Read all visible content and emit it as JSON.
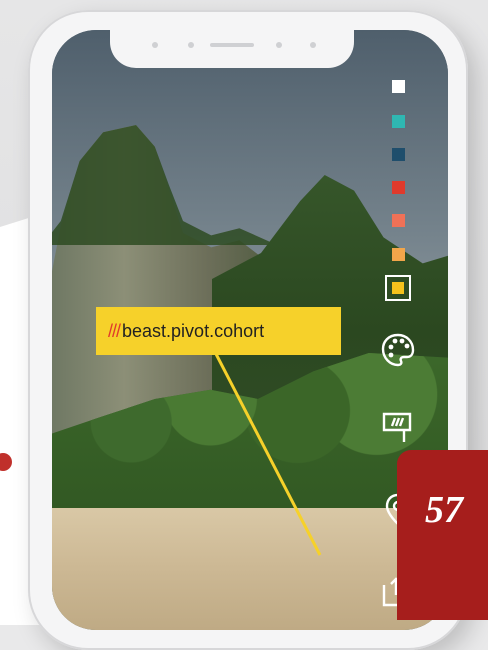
{
  "callout": {
    "slashes": "///",
    "text": "beast.pivot.cohort"
  },
  "page_number": "57",
  "swatches": [
    {
      "name": "white",
      "color": "#ffffff"
    },
    {
      "name": "teal",
      "color": "#2fb7b2"
    },
    {
      "name": "navy",
      "color": "#1f4e6c"
    },
    {
      "name": "red",
      "color": "#e03a2c"
    },
    {
      "name": "coral",
      "color": "#f07157"
    },
    {
      "name": "orange",
      "color": "#f2a64a"
    }
  ],
  "selected_swatch": {
    "name": "yellow",
    "color": "#f6c21c"
  },
  "icons": [
    "palette-icon",
    "flag-icon",
    "location-pin-icon",
    "share-icon"
  ],
  "colors": {
    "accent_yellow": "#f6d12a",
    "accent_red": "#a61e1c",
    "marker_red": "#c0302b"
  }
}
